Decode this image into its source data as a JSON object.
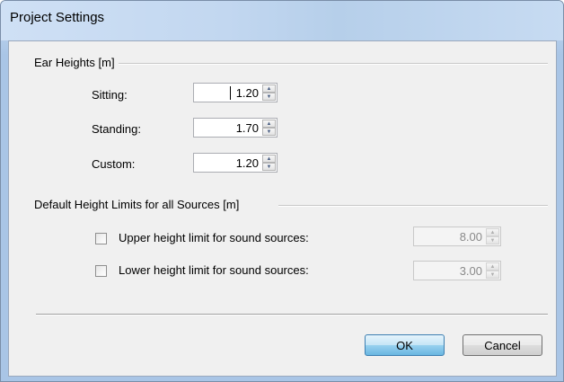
{
  "window": {
    "title": "Project Settings"
  },
  "ear_heights": {
    "group_title": "Ear Heights [m]",
    "rows": [
      {
        "label": "Sitting:",
        "value": "1.20"
      },
      {
        "label": "Standing:",
        "value": "1.70"
      },
      {
        "label": "Custom:",
        "value": "1.20"
      }
    ]
  },
  "height_limits": {
    "group_title": "Default Height Limits for all Sources [m]",
    "rows": [
      {
        "label": "Upper height limit for sound sources:",
        "value": "8.00",
        "checked": false
      },
      {
        "label": "Lower height limit for sound sources:",
        "value": "3.00",
        "checked": false
      }
    ]
  },
  "buttons": {
    "ok": "OK",
    "cancel": "Cancel"
  }
}
